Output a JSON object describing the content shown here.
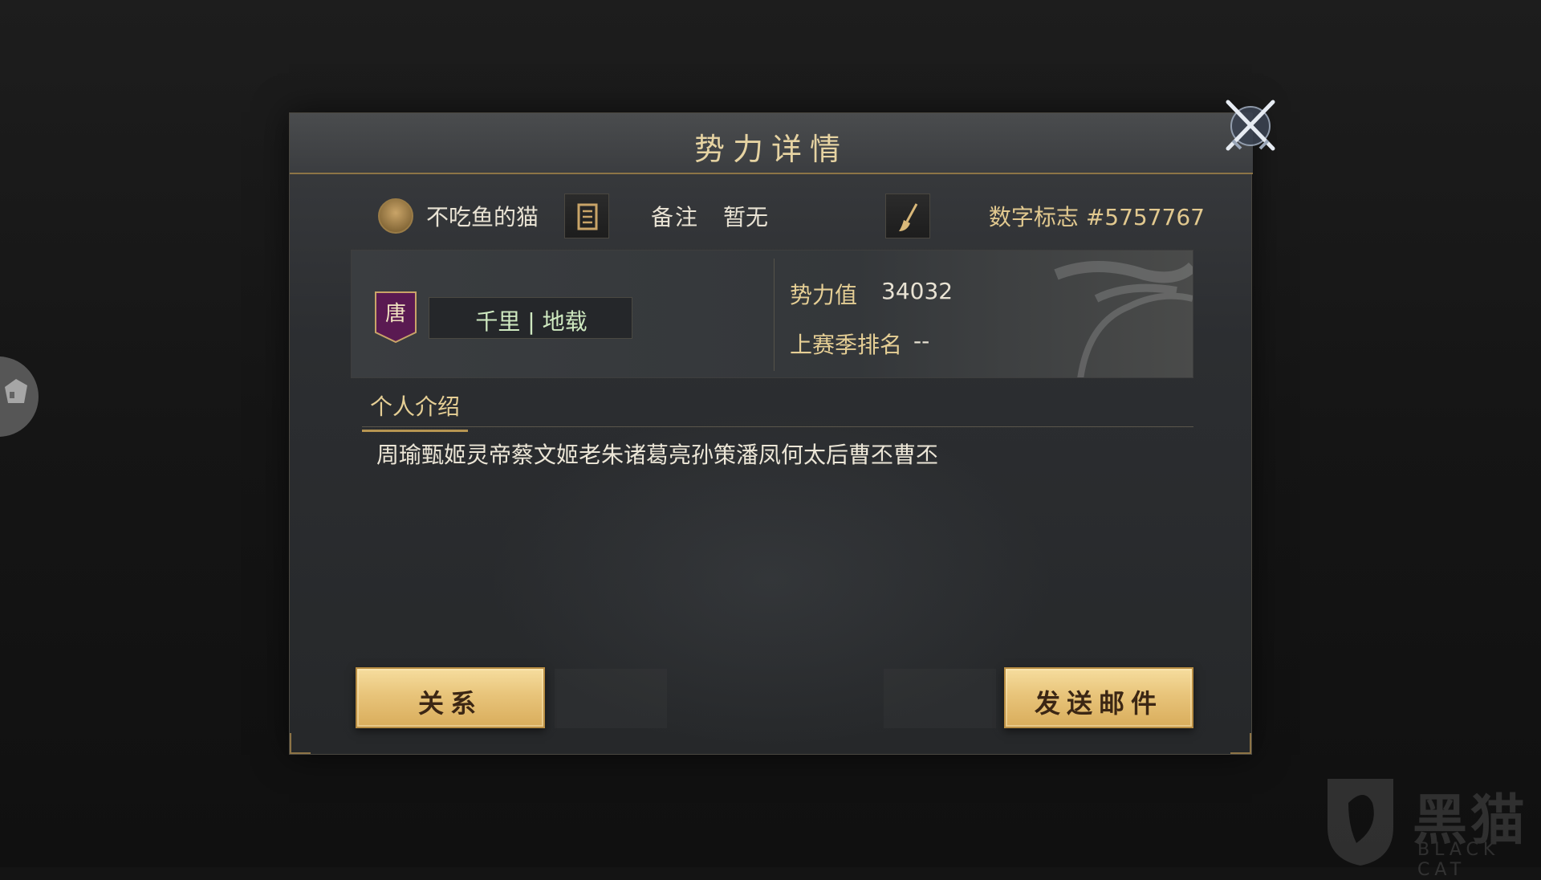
{
  "dialog": {
    "title": "势力详情"
  },
  "player": {
    "name": "不吃鱼的猫",
    "note_label": "备注",
    "note_value": "暂无",
    "digital_id": "数字标志 #5757767"
  },
  "card": {
    "banner_char": "唐",
    "alliance": "千里 | 地载",
    "power_label": "势力值",
    "power_value": "34032",
    "rank_label": "上赛季排名",
    "rank_value": "--"
  },
  "intro": {
    "tab_label": "个人介绍",
    "text": "周瑜甄姬灵帝蔡文姬老朱诸葛亮孙策潘凤何太后曹丕曹丕"
  },
  "buttons": {
    "relation": "关系",
    "send_mail": "发送邮件"
  },
  "watermark": {
    "text": "黑猫",
    "sub": "BLACK CAT"
  },
  "colors": {
    "accent_gold": "#e6cf95",
    "button_gold": "#e8c47a",
    "banner_purple": "#5a1a52",
    "alliance_green": "#cfe9c0"
  },
  "icons": {
    "close": "crossed-swords-icon",
    "avatar": "avatar-icon",
    "copy": "document-icon",
    "edit": "brush-icon",
    "banner": "faction-banner-icon"
  }
}
